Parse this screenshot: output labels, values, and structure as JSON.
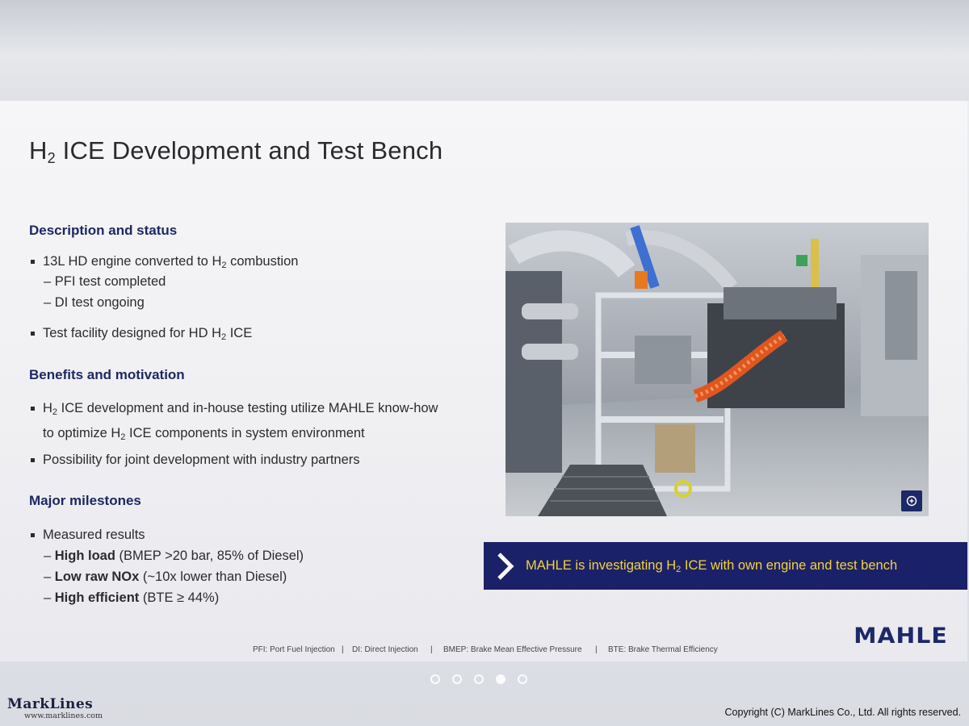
{
  "slide": {
    "title_pre": "H",
    "title_sub": "2",
    "title_post": " ICE Development and Test Bench",
    "sections": {
      "description": {
        "heading": "Description and status",
        "b1_pre": "13L HD engine converted to H",
        "b1_sub": "2",
        "b1_post": " combustion",
        "s1": "– PFI test completed",
        "s2": "– DI test ongoing",
        "b2_pre": "Test facility designed for HD H",
        "b2_sub": "2",
        "b2_post": " ICE"
      },
      "benefits": {
        "heading": "Benefits and motivation",
        "b1_l1_pre": "H",
        "b1_l1_sub": "2",
        "b1_l1_post": " ICE development and in-house testing utilize MAHLE know-how",
        "b1_l2_pre": "to optimize H",
        "b1_l2_sub": "2",
        "b1_l2_post": " ICE components in system environment",
        "b2": "Possibility for joint development with industry partners"
      },
      "milestones": {
        "heading": "Major milestones",
        "b1": "Measured results",
        "s1_bold": "High load",
        "s1_rest": " (BMEP >20 bar, 85% of Diesel)",
        "s2_bold": "Low raw NOx",
        "s2_rest": " (~10x lower than Diesel)",
        "s3_bold": "High efficient",
        "s3_rest": " (BTE ≥ 44%)",
        "dash": "– "
      }
    },
    "banner_pre": "MAHLE is investigating H",
    "banner_sub": "2",
    "banner_post": " ICE with own engine and test bench",
    "logo": "MAHLE",
    "footnotes": {
      "pfi": "PFI: Port Fuel Injection",
      "di": "DI: Direct Injection",
      "bmep": "BMEP: Brake Mean Effective Pressure",
      "bte": "BTE: Brake Thermal Efficiency",
      "sep": "|"
    },
    "zoom_icon": "zoom-icon",
    "colors": {
      "navy": "#1c2868",
      "banner_text": "#f2d33a"
    }
  },
  "pagination": {
    "total": 5,
    "active": 4
  },
  "watermark": {
    "logo": "MarkLines",
    "url": "www.marklines.com",
    "copyright": "Copyright (C) MarkLines Co., Ltd. All rights reserved."
  }
}
